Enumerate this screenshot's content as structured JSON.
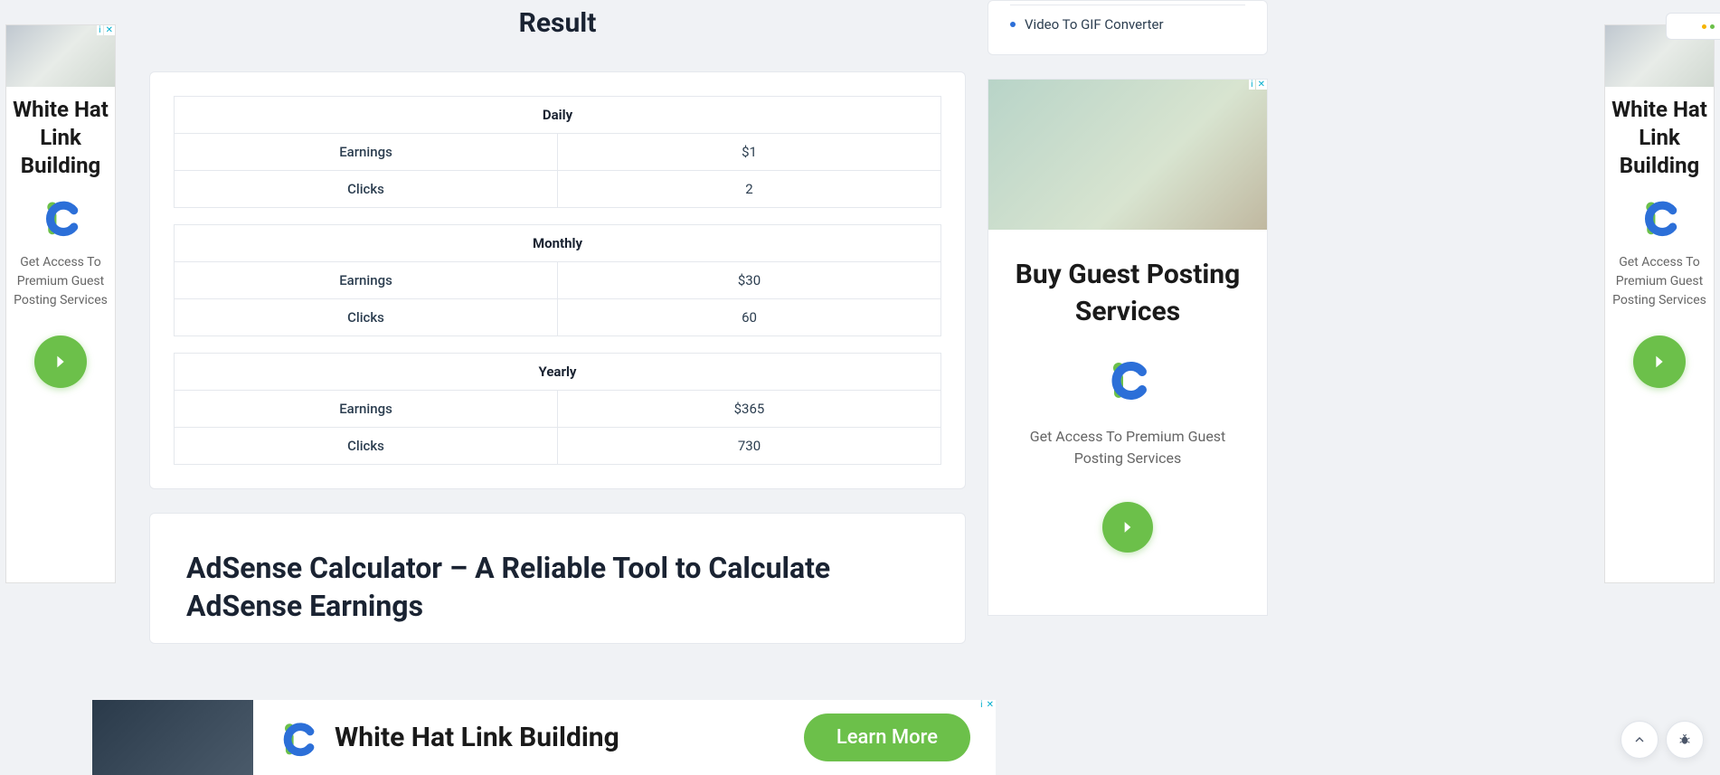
{
  "result": {
    "heading": "Result",
    "periods": [
      {
        "name": "Daily",
        "earnings_label": "Earnings",
        "earnings_value": "$1",
        "clicks_label": "Clicks",
        "clicks_value": "2"
      },
      {
        "name": "Monthly",
        "earnings_label": "Earnings",
        "earnings_value": "$30",
        "clicks_label": "Clicks",
        "clicks_value": "60"
      },
      {
        "name": "Yearly",
        "earnings_label": "Earnings",
        "earnings_value": "$365",
        "clicks_label": "Clicks",
        "clicks_value": "730"
      }
    ]
  },
  "article": {
    "title": "AdSense Calculator – A Reliable Tool to Calculate AdSense Earnings"
  },
  "sidebar": {
    "link_label": "Video To GIF Converter"
  },
  "ads": {
    "skyscraper": {
      "headline": "White Hat Link Building",
      "subtext": "Get Access To Premium Guest Posting Services"
    },
    "sidebar_ad": {
      "headline": "Buy Guest Posting Services",
      "subtext": "Get Access To Premium Guest Posting Services"
    },
    "leaderboard": {
      "headline": "White Hat Link Building",
      "cta": "Learn More"
    },
    "adchoices_info": "i",
    "adchoices_close": "✕"
  },
  "colors": {
    "accent_green": "#6cc04a",
    "link_blue": "#2c6fd8",
    "adchoices": "#00aecd"
  }
}
